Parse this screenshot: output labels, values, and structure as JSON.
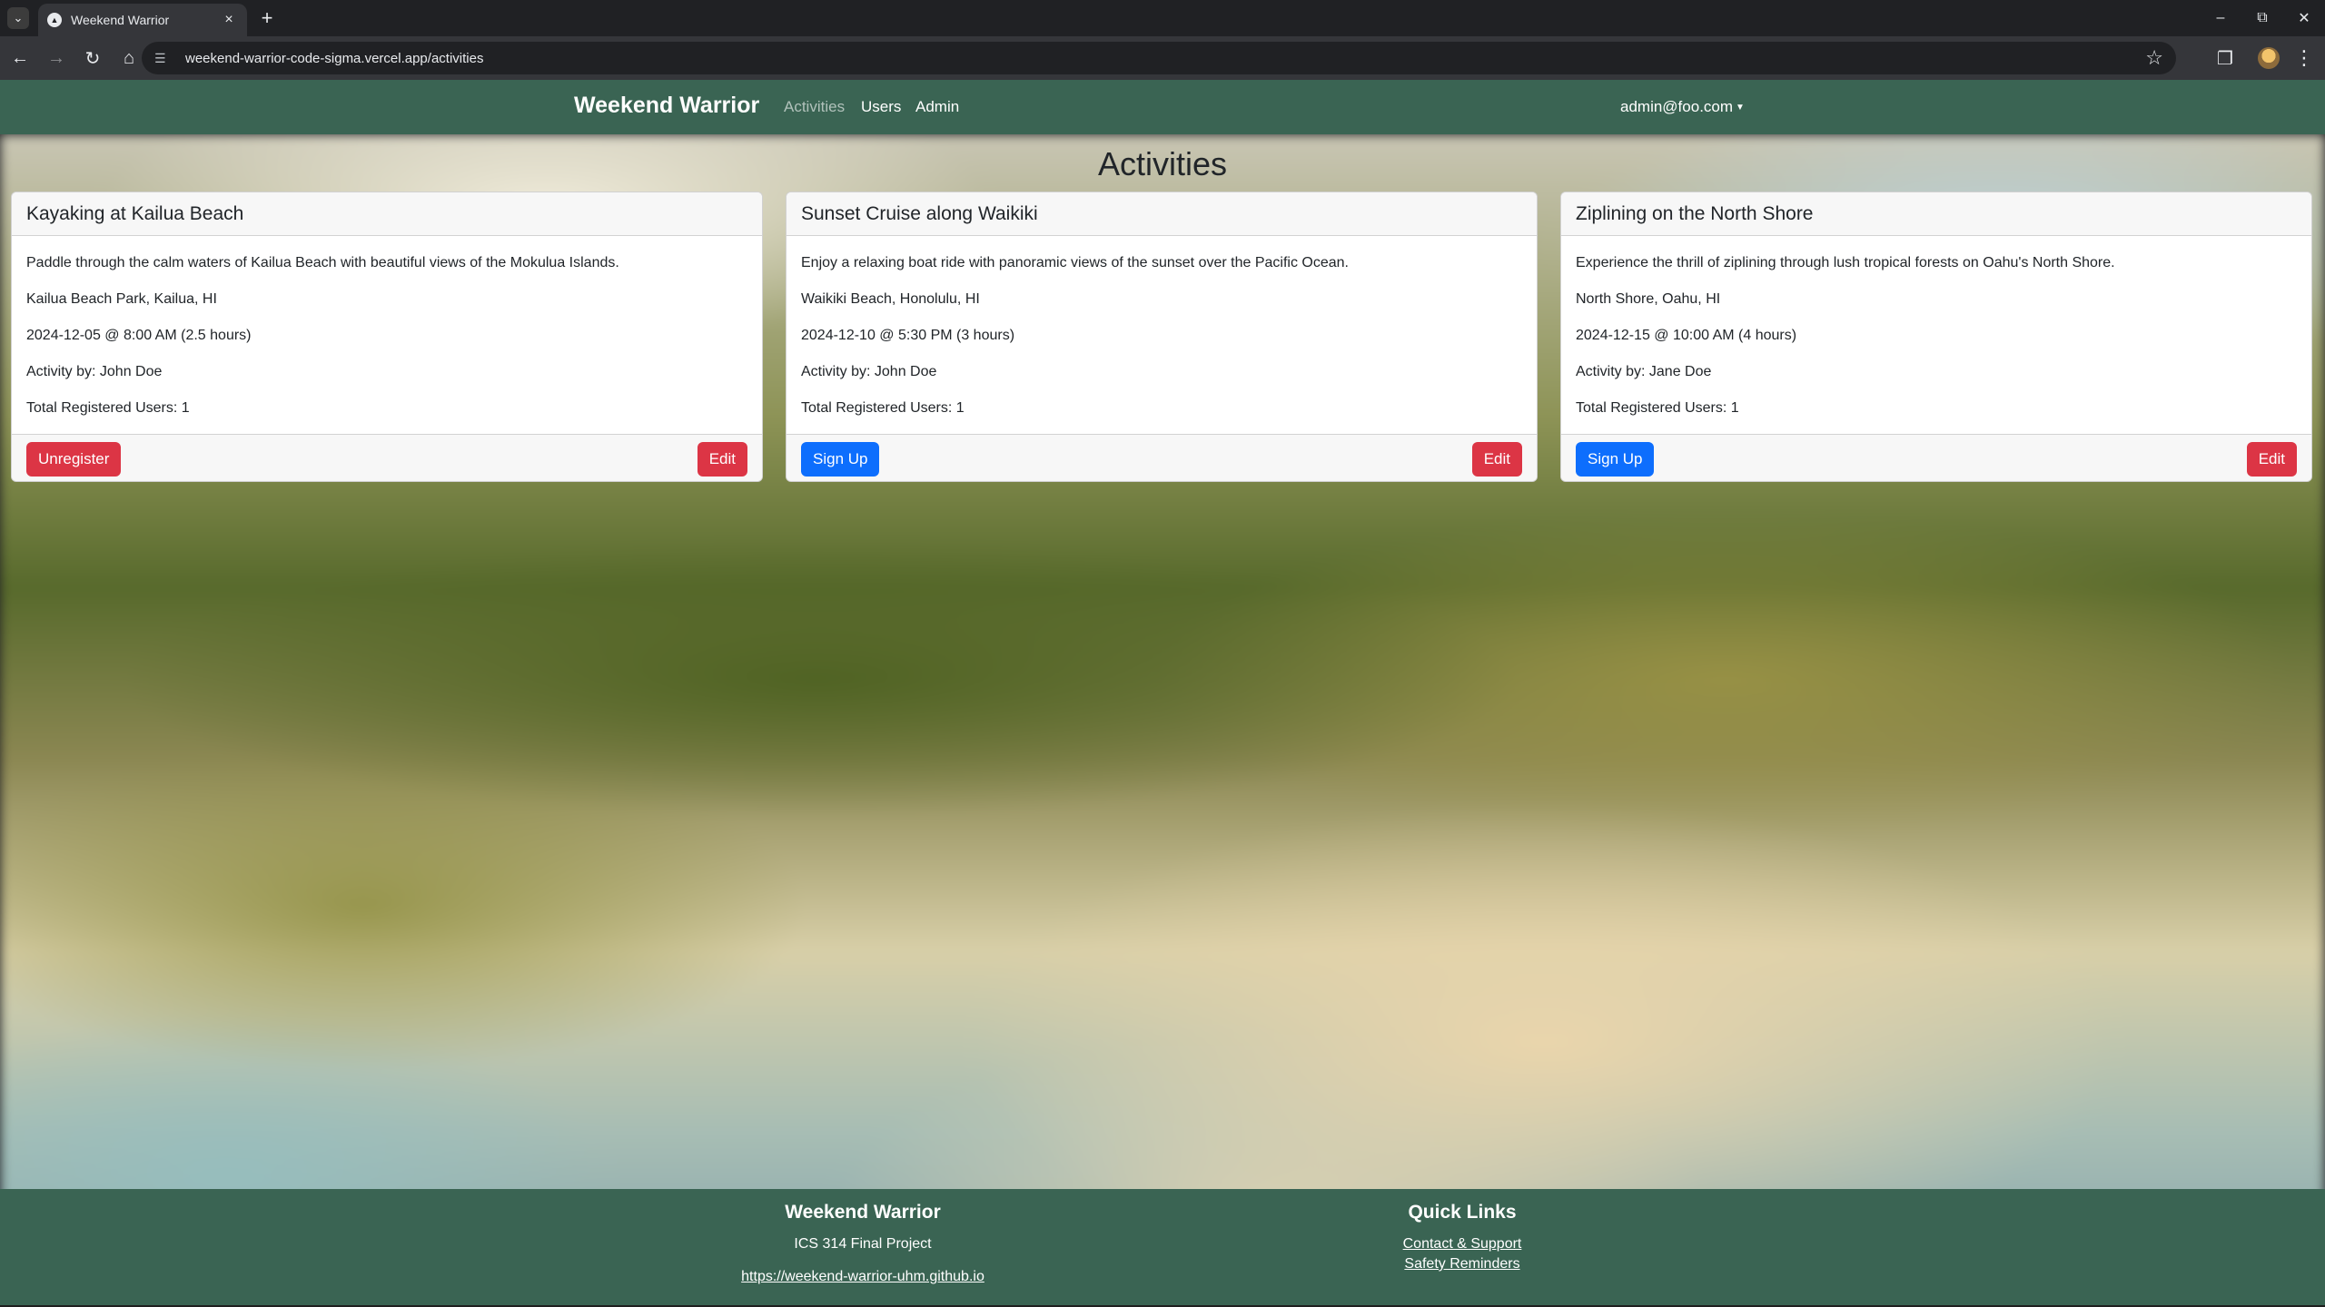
{
  "browser": {
    "tab_title": "Weekend Warrior",
    "url": "weekend-warrior-code-sigma.vercel.app/activities",
    "icons": {
      "tab_list": "chevron-down-icon",
      "favicon": "triangle-icon",
      "tab_close": "close-icon",
      "new_tab": "plus-icon",
      "back": "arrow-left-icon",
      "forward": "arrow-right-icon",
      "reload": "reload-icon",
      "home": "home-icon",
      "site_info": "tune-icon",
      "bookmark": "star-icon",
      "extensions": "puzzle-icon",
      "profile": "avatar",
      "menu": "kebab-icon",
      "minimize": "minimize-icon",
      "restore": "restore-icon",
      "close": "close-icon"
    }
  },
  "navbar": {
    "brand": "Weekend Warrior",
    "links": [
      {
        "label": "Activities",
        "active": true
      },
      {
        "label": "Users",
        "active": false
      },
      {
        "label": "Admin",
        "active": false
      }
    ],
    "user": "admin@foo.com"
  },
  "page": {
    "title": "Activities"
  },
  "activities": [
    {
      "title": "Kayaking at Kailua Beach",
      "description": "Paddle through the calm waters of Kailua Beach with beautiful views of the Mokulua Islands.",
      "location": "Kailua Beach Park, Kailua, HI",
      "datetime": "2024-12-05 @ 8:00 AM (2.5 hours)",
      "owner": "Activity by: John Doe",
      "registered": "Total Registered Users: 1",
      "primary_action": "Unregister",
      "edit_label": "Edit"
    },
    {
      "title": "Sunset Cruise along Waikiki",
      "description": "Enjoy a relaxing boat ride with panoramic views of the sunset over the Pacific Ocean.",
      "location": "Waikiki Beach, Honolulu, HI",
      "datetime": "2024-12-10 @ 5:30 PM (3 hours)",
      "owner": "Activity by: John Doe",
      "registered": "Total Registered Users: 1",
      "primary_action": "Sign Up",
      "edit_label": "Edit"
    },
    {
      "title": "Ziplining on the North Shore",
      "description": "Experience the thrill of ziplining through lush tropical forests on Oahu's North Shore.",
      "location": "North Shore, Oahu, HI",
      "datetime": "2024-12-15 @ 10:00 AM (4 hours)",
      "owner": "Activity by: Jane Doe",
      "registered": "Total Registered Users: 1",
      "primary_action": "Sign Up",
      "edit_label": "Edit"
    }
  ],
  "footer": {
    "brand_heading": "Weekend Warrior",
    "project": "ICS 314 Final Project",
    "site_link": "https://weekend-warrior-uhm.github.io",
    "quick_links_heading": "Quick Links",
    "quick_links": [
      "Contact & Support",
      "Safety Reminders"
    ]
  },
  "colors": {
    "navbar_bg": "#3a6453",
    "danger": "#dc3545",
    "primary": "#0d6efd"
  }
}
